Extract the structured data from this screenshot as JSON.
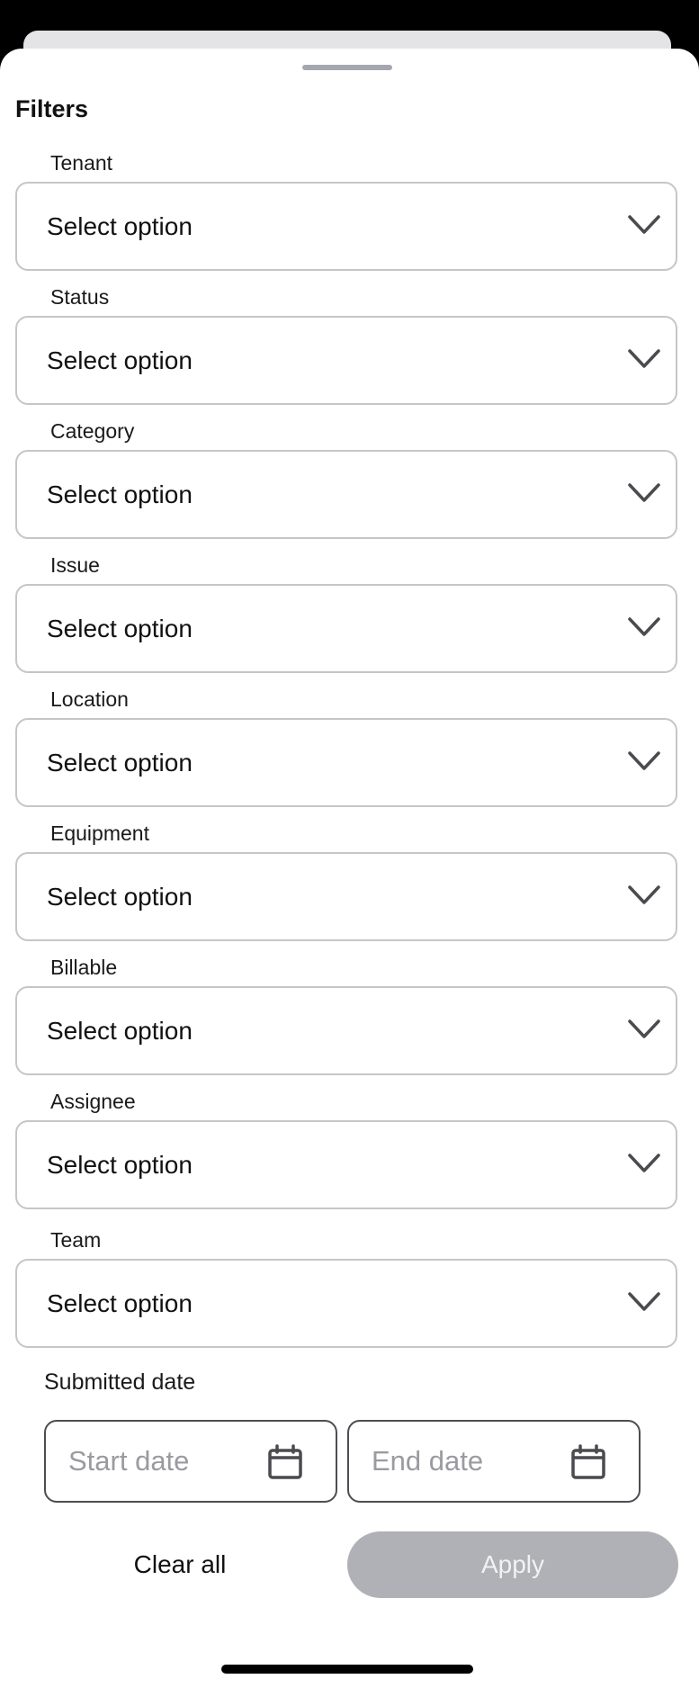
{
  "sheet": {
    "title": "Filters"
  },
  "filters": [
    {
      "label": "Tenant",
      "value": "Select option"
    },
    {
      "label": "Status",
      "value": "Select option"
    },
    {
      "label": "Category",
      "value": "Select option"
    },
    {
      "label": "Issue",
      "value": "Select option"
    },
    {
      "label": "Location",
      "value": "Select option"
    },
    {
      "label": "Equipment",
      "value": "Select option"
    },
    {
      "label": "Billable",
      "value": "Select option"
    },
    {
      "label": "Assignee",
      "value": "Select option"
    },
    {
      "label": "Team",
      "value": "Select option"
    }
  ],
  "submitted_date": {
    "label": "Submitted date",
    "start_placeholder": "Start date",
    "end_placeholder": "End date"
  },
  "actions": {
    "clear_label": "Clear all",
    "apply_label": "Apply"
  },
  "icons": {
    "dropdown": "chevron-down-icon",
    "date": "calendar-icon"
  },
  "colors": {
    "field_border": "#c6c6c9",
    "apply_disabled_bg": "#b0b1b6",
    "placeholder_text": "#9a9aa0"
  }
}
